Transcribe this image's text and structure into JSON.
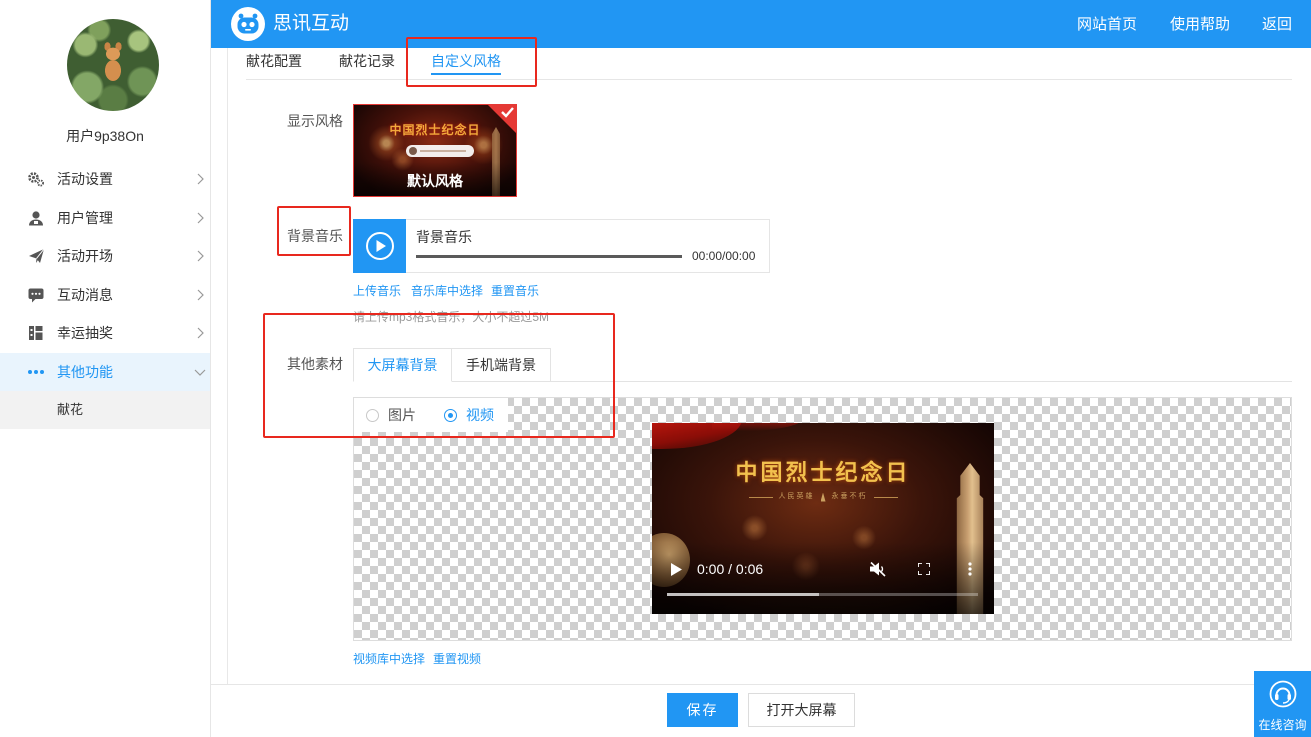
{
  "colors": {
    "primary": "#2196f3",
    "annotation_red": "#e8281e",
    "active_menu_bg": "#e9f4fd"
  },
  "header": {
    "title": "思讯互动",
    "logo_icon": "robot-logo-icon",
    "nav": [
      {
        "label": "网站首页"
      },
      {
        "label": "使用帮助"
      },
      {
        "label": "返回"
      }
    ]
  },
  "sidebar": {
    "username": "用户9p38On",
    "items": [
      {
        "label": "活动设置",
        "icon": "gear-icon"
      },
      {
        "label": "用户管理",
        "icon": "user-icon"
      },
      {
        "label": "活动开场",
        "icon": "paper-plane-icon"
      },
      {
        "label": "互动消息",
        "icon": "chat-icon"
      },
      {
        "label": "幸运抽奖",
        "icon": "lottery-icon"
      },
      {
        "label": "其他功能",
        "icon": "more-dots-icon",
        "active": true,
        "expanded": true
      }
    ],
    "sub_items": [
      {
        "label": "献花",
        "active": true
      }
    ]
  },
  "tabs": [
    {
      "label": "献花配置",
      "active": false
    },
    {
      "label": "献花记录",
      "active": false
    },
    {
      "label": "自定义风格",
      "active": true
    }
  ],
  "display_style": {
    "label": "显示风格",
    "options": [
      {
        "name": "默认风格",
        "poster_title": "中国烈士纪念日",
        "selected": true
      }
    ]
  },
  "bg_music": {
    "label": "背景音乐",
    "track_title": "背景音乐",
    "time": "00:00/00:00",
    "progress": 0,
    "links": [
      "上传音乐",
      "音乐库中选择",
      "重置音乐"
    ],
    "hint": "请上传mp3格式音乐，大小不超过5M"
  },
  "materials": {
    "label": "其他素材",
    "tabs": [
      {
        "label": "大屏幕背景",
        "active": true
      },
      {
        "label": "手机端背景",
        "active": false
      }
    ],
    "media_type": {
      "options": [
        "图片",
        "视频"
      ],
      "selected": "视频"
    },
    "video": {
      "poster_title": "中国烈士纪念日",
      "poster_subtitle_left": "人民英雄",
      "poster_subtitle_right": "永垂不朽",
      "time": "0:00 / 0:06",
      "buffered": 0.49,
      "muted": true
    },
    "links": [
      "视频库中选择",
      "重置视频"
    ]
  },
  "footer": {
    "save_label": "保存",
    "open_screen_label": "打开大屏幕"
  },
  "consult": {
    "label": "在线咨询",
    "icon": "headset-icon"
  }
}
